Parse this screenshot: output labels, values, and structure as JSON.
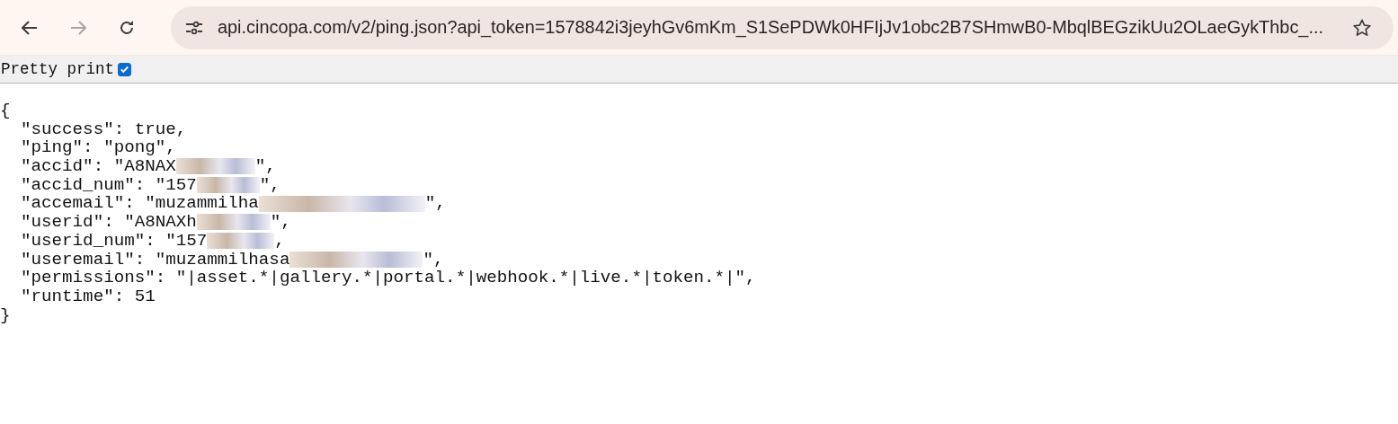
{
  "browser": {
    "url": "api.cincopa.com/v2/ping.json?api_token=1578842i3jeyhGv6mKm_S1SePDWk0HFIjJv1obc2B7SHmwB0-MbqlBEGzikUu2OLaeGykThbc_...",
    "forward_disabled": true
  },
  "pretty_print": {
    "label": "Pretty print",
    "checked": true
  },
  "json_lines": [
    {
      "text": "{",
      "redacted": false
    },
    {
      "text": "  \"success\": true,",
      "redacted": false
    },
    {
      "text": "  \"ping\": \"pong\",",
      "redacted": false
    },
    {
      "text": "  \"accid\": \"A8NAX",
      "redacted": true,
      "after": "\","
    },
    {
      "text": "  \"accid_num\": \"157",
      "redacted": true,
      "after": "\","
    },
    {
      "text": "  \"accemail\": \"muzammilha",
      "redacted": true,
      "after": "\","
    },
    {
      "text": "  \"userid\": \"A8NAXh",
      "redacted": true,
      "after": "\","
    },
    {
      "text": "  \"userid_num\": \"157",
      "redacted": true,
      "after": ","
    },
    {
      "text": "  \"useremail\": \"muzammilhasa",
      "redacted": true,
      "after": "\","
    },
    {
      "text": "  \"permissions\": \"|asset.*|gallery.*|portal.*|webhook.*|live.*|token.*|\",",
      "redacted": false
    },
    {
      "text": "  \"runtime\": 51",
      "redacted": false
    },
    {
      "text": "}",
      "redacted": false
    }
  ]
}
